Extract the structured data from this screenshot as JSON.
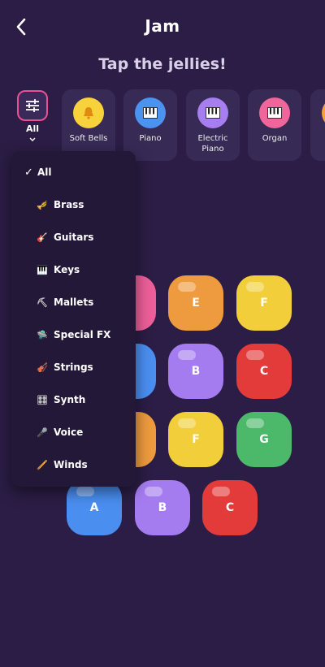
{
  "header": {
    "title": "Jam"
  },
  "subtitle": "Tap the jellies!",
  "filter": {
    "label": "All"
  },
  "categories": [
    {
      "label": "Soft Bells",
      "color": "#f7d23b",
      "icon": "bell-icon"
    },
    {
      "label": "Piano",
      "color": "#4c92ef",
      "icon": "keyboard-icon"
    },
    {
      "label": "Electric Piano",
      "color": "#a77ef0",
      "icon": "keyboard-icon"
    },
    {
      "label": "Organ",
      "color": "#f0669a",
      "icon": "keyboard-icon"
    },
    {
      "label": "",
      "color": "#f3a13d",
      "icon": "partial-card"
    }
  ],
  "dropdown": {
    "items": [
      {
        "label": "All",
        "selected": true,
        "icon": "checkmark-icon"
      },
      {
        "label": "Brass",
        "icon": "trumpet-icon"
      },
      {
        "label": "Guitars",
        "icon": "guitar-icon"
      },
      {
        "label": "Keys",
        "icon": "keys-icon"
      },
      {
        "label": "Mallets",
        "icon": "mallet-icon"
      },
      {
        "label": "Special FX",
        "icon": "ufo-icon"
      },
      {
        "label": "Strings",
        "icon": "violin-icon"
      },
      {
        "label": "Synth",
        "icon": "synth-icon"
      },
      {
        "label": "Voice",
        "icon": "microphone-icon"
      },
      {
        "label": "Winds",
        "icon": "winds-icon"
      }
    ]
  },
  "jellies": [
    {
      "note": "",
      "color": "#ec5f9a"
    },
    {
      "note": "E",
      "color": "#ee9a3e"
    },
    {
      "note": "F",
      "color": "#f2cf3a"
    },
    {
      "note": "",
      "color": "#4a8ef0"
    },
    {
      "note": "B",
      "color": "#a57cf0"
    },
    {
      "note": "C",
      "color": "#e33a3a"
    },
    {
      "note": "",
      "color": "#ee9a3e"
    },
    {
      "note": "F",
      "color": "#f2cf3a"
    },
    {
      "note": "G",
      "color": "#4cb86a"
    },
    {
      "note": "A",
      "color": "#4a8ef0"
    },
    {
      "note": "B",
      "color": "#a57cf0"
    },
    {
      "note": "C",
      "color": "#e33a3a"
    }
  ]
}
